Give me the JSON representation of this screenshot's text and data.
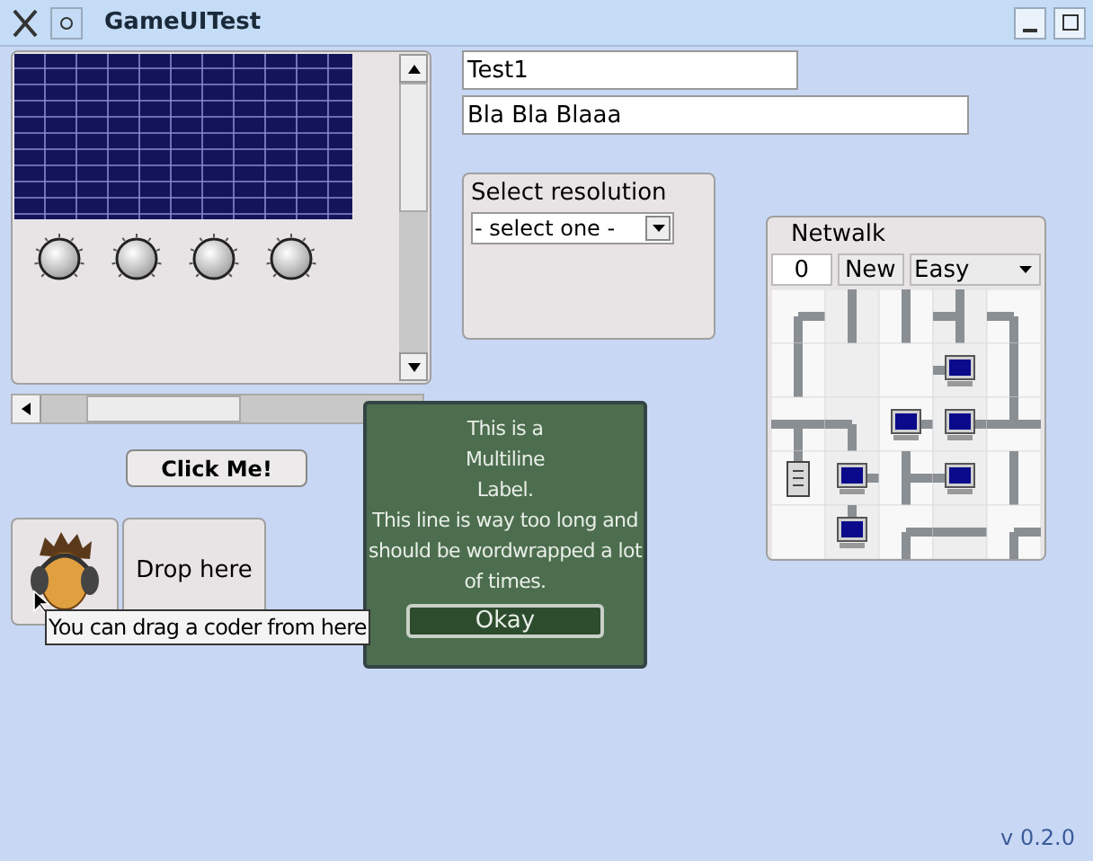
{
  "window": {
    "title": "GameUITest"
  },
  "text_fields": [
    {
      "value": "Test1"
    },
    {
      "value": "Bla Bla Blaaa"
    }
  ],
  "resolution_panel": {
    "title": "Select resolution",
    "dropdown": {
      "value": "- select one -"
    }
  },
  "netwalk": {
    "title": "Netwalk",
    "score": "0",
    "new_button": "New",
    "difficulty": "Easy"
  },
  "click_button": "Click Me!",
  "drop_target": "Drop here",
  "tooltip": "You can drag a coder from here",
  "dialog": {
    "label": "This is a\nMultiline\nLabel.\nThis line is way too long and should be wordwrapped a lot of times.",
    "button": "Okay"
  },
  "version": "v 0.2.0"
}
